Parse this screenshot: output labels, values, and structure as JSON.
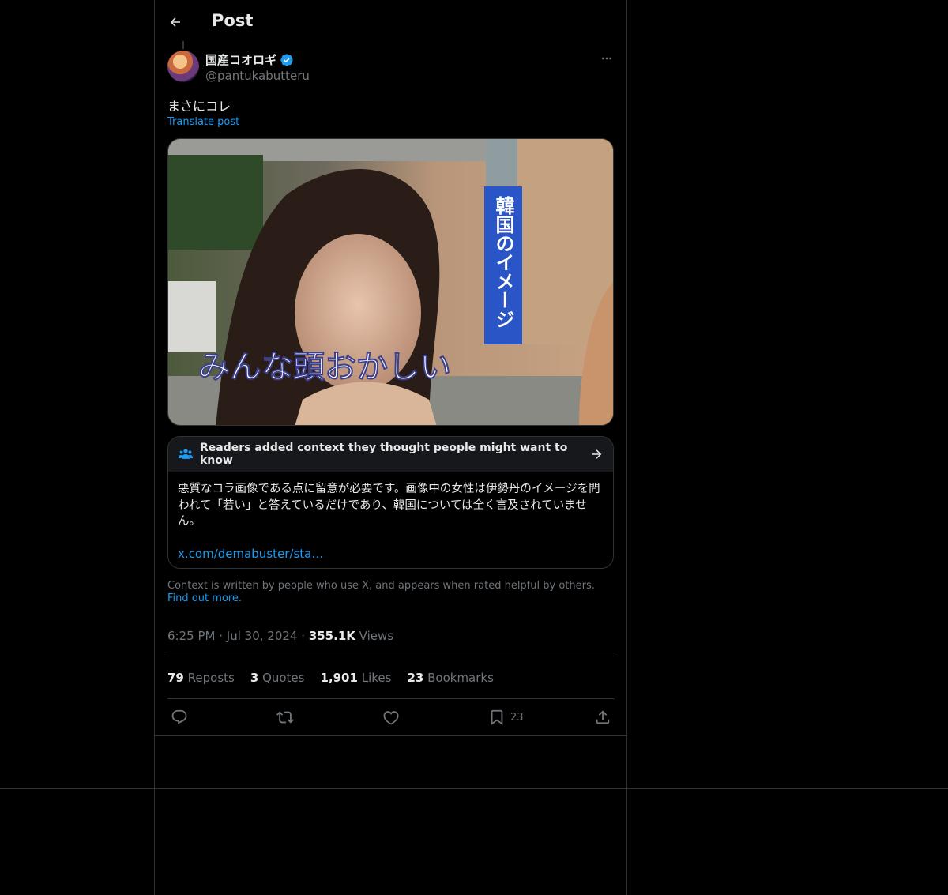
{
  "header": {
    "title": "Post"
  },
  "author": {
    "name": "国産コオロギ",
    "handle": "@pantukabutteru"
  },
  "tweet": {
    "text": "まさにコレ",
    "translate_label": "Translate post"
  },
  "media": {
    "overlay_vertical": "韓国のイメージ",
    "overlay_caption": "みんな頭おかしい"
  },
  "community_note": {
    "header": "Readers added context they thought people might want to know",
    "body": "悪質なコラ画像である点に留意が必要です。画像中の女性は伊勢丹のイメージを問われて「若い」と答えているだけであり、韓国については全く言及されていません。",
    "link": "x.com/demabuster/sta…"
  },
  "context_note": {
    "text": "Context is written by people who use X, and appears when rated helpful by others.",
    "link": "Find out more."
  },
  "meta": {
    "time": "6:25 PM",
    "date": "Jul 30, 2024",
    "views_count": "355.1K",
    "views_label": "Views",
    "dot": "·"
  },
  "stats": {
    "reposts_count": "79",
    "reposts_label": "Reposts",
    "quotes_count": "3",
    "quotes_label": "Quotes",
    "likes_count": "1,901",
    "likes_label": "Likes",
    "bookmarks_count": "23",
    "bookmarks_label": "Bookmarks"
  },
  "actions": {
    "bookmark_count": "23"
  },
  "colors": {
    "accent": "#1d9bf0",
    "text": "#e7e9ea",
    "muted": "#71767b",
    "border": "#2f3336",
    "background": "#000000"
  }
}
